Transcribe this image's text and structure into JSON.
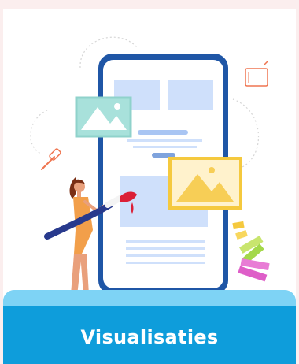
{
  "card": {
    "title": "Visualisaties",
    "accent_color": "#0e9ddb",
    "accent_light": "#7ed3f5",
    "phone_frame_color": "#1f56a6",
    "illustration": "designer-painting-phone-mockup"
  }
}
